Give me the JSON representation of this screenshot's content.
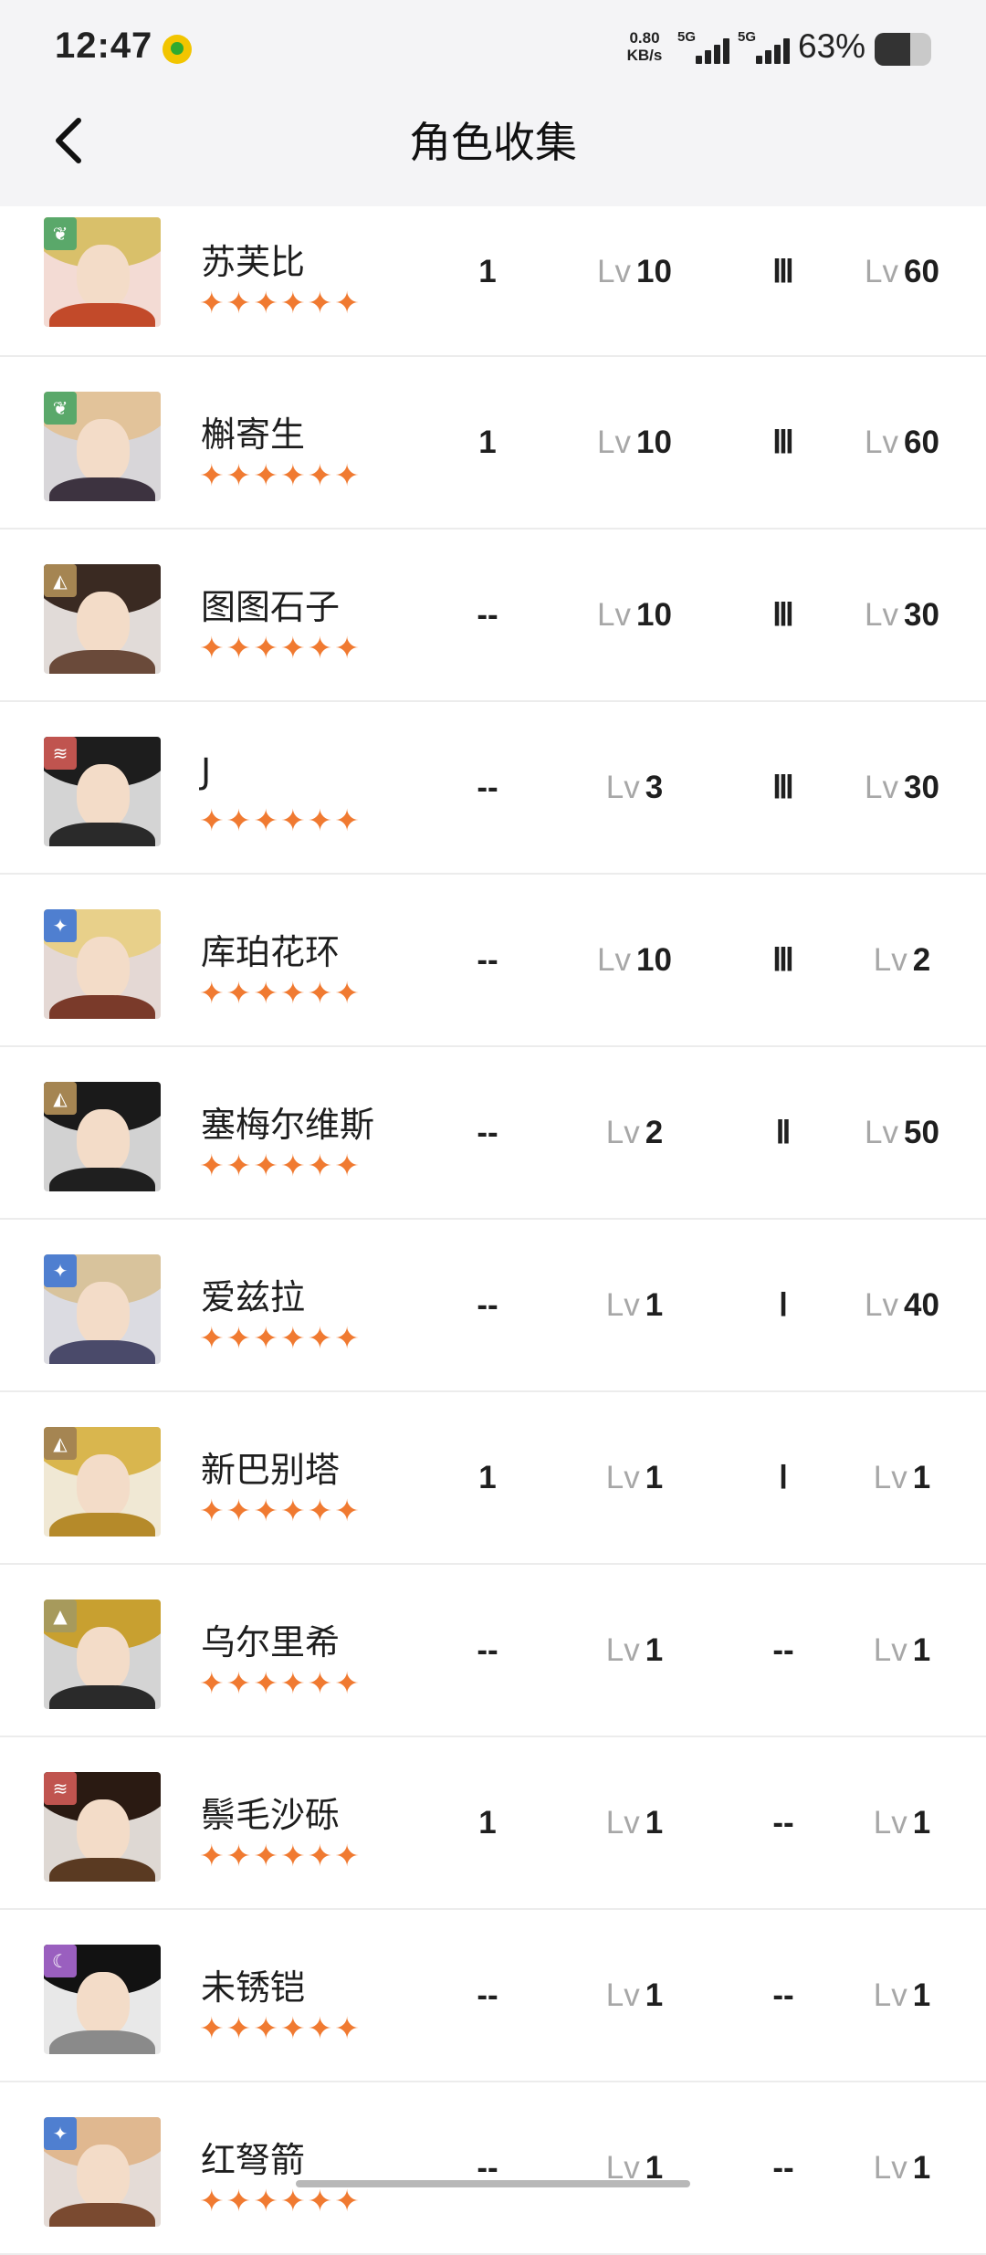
{
  "status_bar": {
    "time": "12:47",
    "net_speed_value": "0.80",
    "net_speed_unit": "KB/s",
    "signal1_label": "5G",
    "signal2_label": "5G",
    "battery_text": "63%",
    "battery_level": 0.63
  },
  "header": {
    "title": "角色收集",
    "back_icon": "chevron-left-icon"
  },
  "lv_prefix": "Lv",
  "star_icon": "star-icon",
  "star_color": "#f07a31",
  "characters": [
    {
      "name": "苏芙比",
      "element": "plant",
      "element_color": "#5aa86a",
      "stars": 6,
      "col1": "1",
      "level": "10",
      "rank": "Ⅲ",
      "skill_level": "60"
    },
    {
      "name": "槲寄生",
      "element": "plant",
      "element_color": "#5aa86a",
      "stars": 6,
      "col1": "1",
      "level": "10",
      "rank": "Ⅲ",
      "skill_level": "60"
    },
    {
      "name": "图图石子",
      "element": "mineral",
      "element_color": "#a58552",
      "stars": 6,
      "col1": "--",
      "level": "10",
      "rank": "Ⅲ",
      "skill_level": "30"
    },
    {
      "name": "J",
      "element": "beast",
      "element_color": "#c0544f",
      "stars": 6,
      "col1": "--",
      "level": "3",
      "rank": "Ⅲ",
      "skill_level": "30"
    },
    {
      "name": "库珀花环",
      "element": "star",
      "element_color": "#4f7fd0",
      "stars": 6,
      "col1": "--",
      "level": "10",
      "rank": "Ⅲ",
      "skill_level": "2"
    },
    {
      "name": "塞梅尔维斯",
      "element": "mineral",
      "element_color": "#a58552",
      "stars": 6,
      "col1": "--",
      "level": "2",
      "rank": "Ⅱ",
      "skill_level": "50"
    },
    {
      "name": "爱兹拉",
      "element": "star",
      "element_color": "#4f7fd0",
      "stars": 6,
      "col1": "--",
      "level": "1",
      "rank": "Ⅰ",
      "skill_level": "40"
    },
    {
      "name": "新巴别塔",
      "element": "mineral",
      "element_color": "#a58552",
      "stars": 6,
      "col1": "1",
      "level": "1",
      "rank": "Ⅰ",
      "skill_level": "1"
    },
    {
      "name": "乌尔里希",
      "element": "intellect",
      "element_color": "#a79a5c",
      "stars": 6,
      "col1": "--",
      "level": "1",
      "rank": "--",
      "skill_level": "1"
    },
    {
      "name": "鬃毛沙砾",
      "element": "beast",
      "element_color": "#c0544f",
      "stars": 6,
      "col1": "1",
      "level": "1",
      "rank": "--",
      "skill_level": "1"
    },
    {
      "name": "未锈铠",
      "element": "spirit",
      "element_color": "#9a5fbf",
      "stars": 6,
      "col1": "--",
      "level": "1",
      "rank": "--",
      "skill_level": "1"
    },
    {
      "name": "红弩箭",
      "element": "star",
      "element_color": "#4f7fd0",
      "stars": 6,
      "col1": "--",
      "level": "1",
      "rank": "--",
      "skill_level": "1"
    }
  ]
}
